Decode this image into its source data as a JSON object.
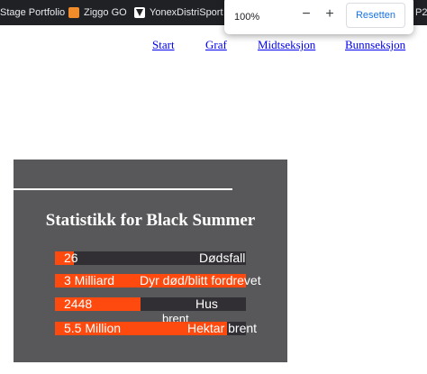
{
  "bookmarks_bar": {
    "items": [
      {
        "label": "Stage Portfolio",
        "icon": "bookmark-icon"
      },
      {
        "label": "Ziggo GO",
        "icon": "ziggo-logo-icon"
      },
      {
        "label": "YonexDistriSport",
        "icon": "yonex-logo-icon"
      }
    ],
    "overflow_label": "P2"
  },
  "zoom_popup": {
    "value": "100%",
    "decrease_icon": "−",
    "increase_icon": "+",
    "reset_label": "Resetten"
  },
  "nav": {
    "links": [
      "Start",
      "Graf",
      "Midtseksjon",
      "Bunnseksjon"
    ]
  },
  "stats_card": {
    "title": "Statistikk for Black Summer",
    "rows": [
      {
        "value": "26",
        "label": "Dødsfall",
        "fill": 0.1
      },
      {
        "value": "3 Milliard",
        "label": "Dyr død/blitt fordrevet",
        "fill": 1.0
      },
      {
        "value": "2448",
        "label": "Hus",
        "fill": 0.45
      },
      {
        "value": "5.5 Million",
        "label": "Hektar brent",
        "fill": 0.9
      }
    ],
    "overlap_text": "brent"
  },
  "colors": {
    "browser_bar": "#202124",
    "card_bg": "#58585a",
    "bar_track": "#312f34",
    "bar_fill": "#ff4a0f",
    "link": "#0000ee",
    "reset_text": "#1a73e8"
  }
}
